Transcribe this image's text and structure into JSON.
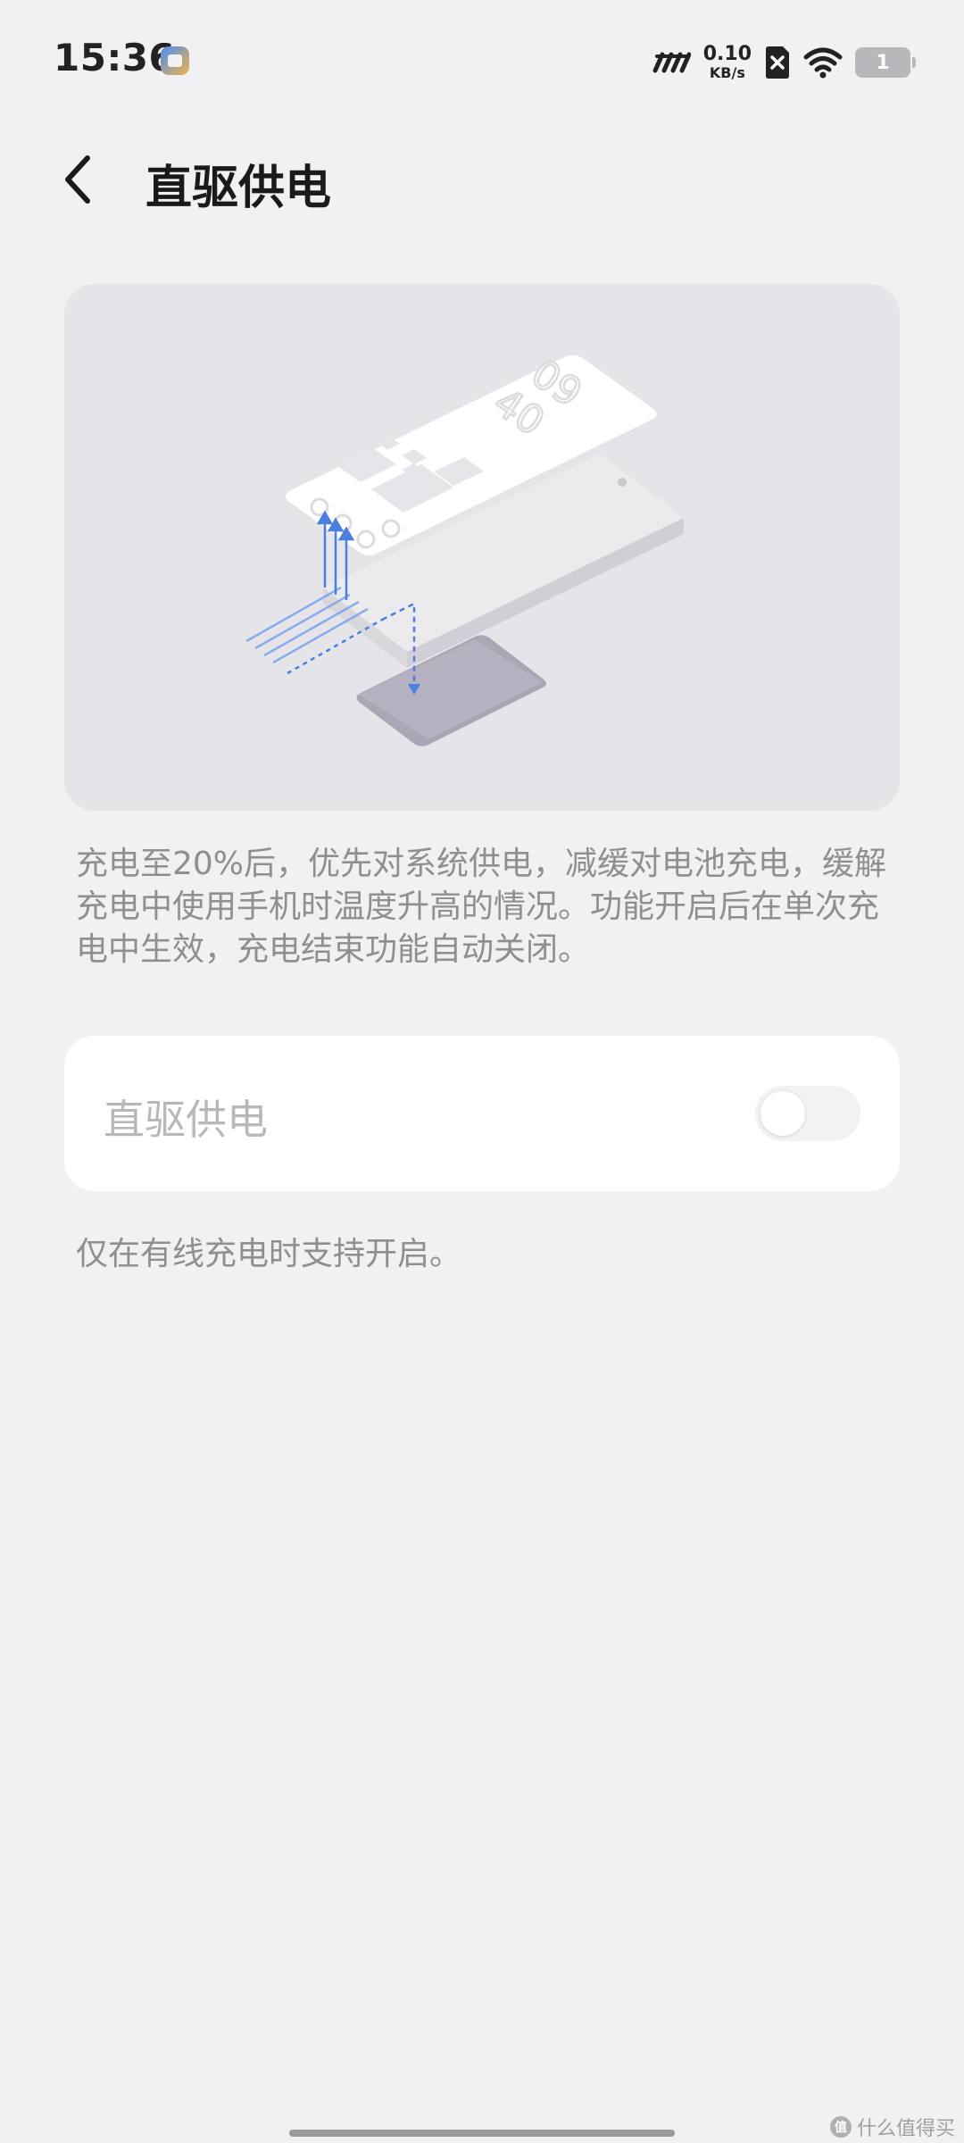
{
  "status_bar": {
    "time": "15:36",
    "net_speed_value": "0.10",
    "net_speed_unit": "KB/s",
    "battery_level": "1",
    "icons": [
      "app-notification-icon",
      "hd-signal-icon",
      "no-sim-icon",
      "wifi-icon",
      "battery-icon"
    ]
  },
  "header": {
    "title": "直驱供电",
    "back_icon": "chevron-left-icon"
  },
  "illustration": {
    "clock_top": "09",
    "clock_bottom": "40"
  },
  "description": "充电至20%后，优先对系统供电，减缓对电池充电，缓解充电中使用手机时温度升高的情况。功能开启后在单次充电中生效，充电结束功能自动关闭。",
  "toggle": {
    "label": "直驱供电",
    "enabled": false,
    "disabled": true
  },
  "footnote": "仅在有线充电时支持开启。",
  "watermark": {
    "badge": "值",
    "text": "什么值得买"
  },
  "colors": {
    "background": "#f1f1f3",
    "card": "#ffffff",
    "illustration_bg": "#e5e5e9",
    "secondary_text": "#8e8e93",
    "arrow_blue": "#4a7fe0"
  }
}
